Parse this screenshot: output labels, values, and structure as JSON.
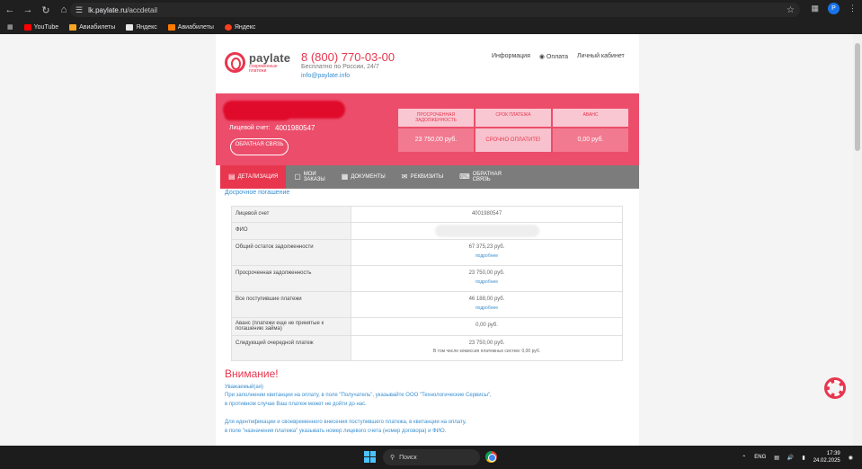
{
  "browser": {
    "url_host": "lk.paylate.ru",
    "url_path": "/accdetail",
    "profile_initial": "P",
    "bookmarks": [
      {
        "label": "YouTube",
        "color": "#ff0000"
      },
      {
        "label": "Авиабилеты",
        "color": "#f5a623"
      },
      {
        "label": "Яндекс",
        "color": "#e8e8e8"
      },
      {
        "label": "Авиабилеты",
        "color": "#ff7a00"
      },
      {
        "label": "Яндекс",
        "color": "#fc3f1d"
      }
    ]
  },
  "header": {
    "logo_name": "paylate",
    "logo_slogan": "современные платежи",
    "phone": "8 (800) 770-03-00",
    "free_call": "Бесплатно по России, 24/7",
    "email": "info@paylate.info",
    "nav": [
      "Информация",
      "Оплата",
      "Личный кабинет"
    ]
  },
  "account": {
    "label": "Лицевой счет:",
    "number": "4001980547",
    "feedback_btn": "ОБРАТНАЯ СВЯЗЬ"
  },
  "cards": [
    {
      "header": "ПРОСРОЧЕННАЯ ЗАДОЛЖЕННОСТЬ",
      "value": "23 750,00 руб."
    },
    {
      "header": "СРОК ПЛАТЕЖА",
      "value": "СРОЧНО ОПЛАТИТЕ!"
    },
    {
      "header": "АВАНС",
      "value": "0,00 руб."
    }
  ],
  "tabs": [
    {
      "label": "ДЕТАЛИЗАЦИЯ",
      "icon": "detail-icon"
    },
    {
      "label": "МОИ ЗАКАЗЫ",
      "icon": "box-icon"
    },
    {
      "label": "ДОКУМЕНТЫ",
      "icon": "document-icon"
    },
    {
      "label": "РЕКВИЗИТЫ",
      "icon": "mail-icon"
    },
    {
      "label": "ОБРАТНАЯ СВЯЗЬ",
      "icon": "chat-icon"
    }
  ],
  "early_repayment": "Досрочное погашение",
  "table": {
    "rows": [
      {
        "label": "Лицевой счет",
        "value": "4001980547",
        "more": ""
      },
      {
        "label": "ФИО",
        "value": "",
        "more": ""
      },
      {
        "label": "Общий остаток задолженности",
        "value": "67 375,23 руб.",
        "more": "подробнее"
      },
      {
        "label": "Просроченная задолженность",
        "value": "23 750,00 руб.",
        "more": "подробнее"
      },
      {
        "label": "Все поступившие платежи",
        "value": "46 188,00 руб.",
        "more": "подробнее"
      },
      {
        "label": "Аванс (платежи еще не принятые к погашению займа)",
        "value": "0,00 руб.",
        "more": ""
      },
      {
        "label": "Следующий очередной платеж",
        "value": "23 750,00 руб.",
        "more": "В том числе комиссия платежных систем: 0,00 руб."
      }
    ]
  },
  "warning": {
    "title": "Внимание!",
    "lines": [
      "Уважаемый(ая)",
      "При заполнении квитанции на оплату, в поле \"Получатель\", указывайте ООО \"Технологические Сервисы\",",
      "в противном случае Ваш платеж может не дойти до нас.",
      "Для идентификации и своевременного внесения поступившего платежа, в квитанции на оплату,",
      "в поле \"назначения платежа\" указывать номер лицевого счета (номер договора) и ФИО."
    ]
  },
  "taskbar": {
    "search_placeholder": "Поиск",
    "lang": "ENG",
    "time": "17:39",
    "date": "24.02.2025"
  }
}
